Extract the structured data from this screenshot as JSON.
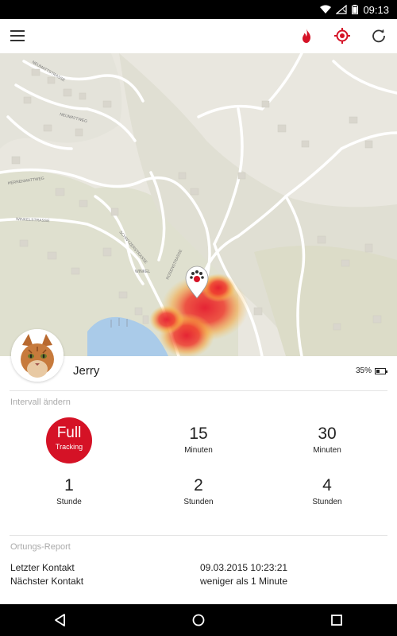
{
  "status_bar": {
    "time": "09:13",
    "icons": [
      "wifi-icon",
      "no-signal-icon",
      "battery-icon"
    ]
  },
  "app_bar": {
    "icons": [
      "menu-icon",
      "heatmap-flame-icon",
      "locate-target-icon",
      "refresh-icon"
    ],
    "accent_color": "#d51226"
  },
  "pet": {
    "name": "Jerry",
    "battery_percent_label": "35%",
    "battery_level": 0.35
  },
  "interval": {
    "section_label": "Intervall ändern",
    "selected": {
      "line1": "Full",
      "line2": "Tracking"
    },
    "options": [
      {
        "value": "15",
        "unit": "Minuten"
      },
      {
        "value": "30",
        "unit": "Minuten"
      },
      {
        "value": "1",
        "unit": "Stunde"
      },
      {
        "value": "2",
        "unit": "Stunden"
      },
      {
        "value": "4",
        "unit": "Stunden"
      }
    ]
  },
  "report": {
    "section_label": "Ortungs-Report",
    "rows": [
      {
        "label": "Letzter Kontakt",
        "value": "09.03.2015 10:23:21"
      },
      {
        "label": "Nächster Kontakt",
        "value": "weniger als 1 Minute"
      }
    ]
  },
  "map": {
    "street_labels": [
      "NEUMATTSTRASSE",
      "NEUMATTWEG",
      "HERRENMATTWEG",
      "WINKELSTRASSE",
      "SCHWYZERSTRASSE",
      "WINKEL",
      "ROSENSTRASSE"
    ],
    "marker": "paw-pin-icon"
  },
  "nav_bar": {
    "icons": [
      "back-icon",
      "home-icon",
      "recents-icon"
    ]
  }
}
